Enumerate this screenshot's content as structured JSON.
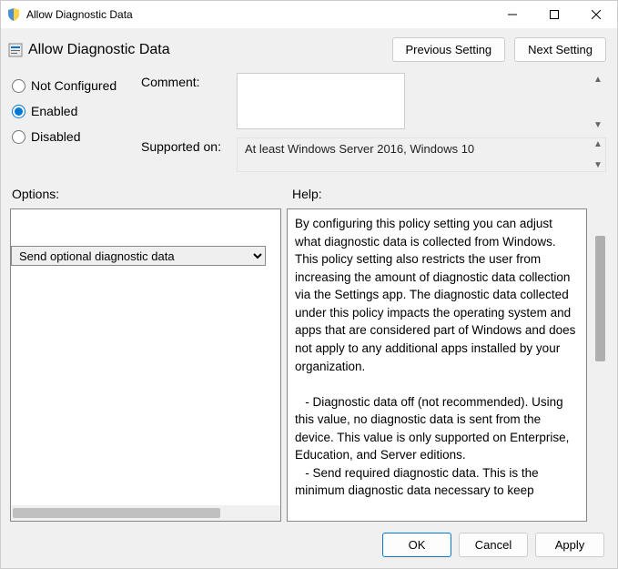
{
  "window": {
    "title": "Allow Diagnostic Data"
  },
  "header": {
    "title": "Allow Diagnostic Data",
    "prev_button": "Previous Setting",
    "next_button": "Next Setting"
  },
  "config": {
    "radios": {
      "not_configured": "Not Configured",
      "enabled": "Enabled",
      "disabled": "Disabled",
      "selected": "enabled"
    },
    "comment_label": "Comment:",
    "comment_value": "",
    "supported_label": "Supported on:",
    "supported_value": "At least Windows Server 2016, Windows 10"
  },
  "panels": {
    "options_label": "Options:",
    "help_label": "Help:",
    "options_select_value": "Send optional diagnostic data",
    "help_text": "By configuring this policy setting you can adjust what diagnostic data is collected from Windows. This policy setting also restricts the user from increasing the amount of diagnostic data collection via the Settings app. The diagnostic data collected under this policy impacts the operating system and apps that are considered part of Windows and does not apply to any additional apps installed by your organization.\n\n   - Diagnostic data off (not recommended). Using this value, no diagnostic data is sent from the device. This value is only supported on Enterprise, Education, and Server editions.\n   - Send required diagnostic data. This is the minimum diagnostic data necessary to keep"
  },
  "footer": {
    "ok": "OK",
    "cancel": "Cancel",
    "apply": "Apply"
  }
}
